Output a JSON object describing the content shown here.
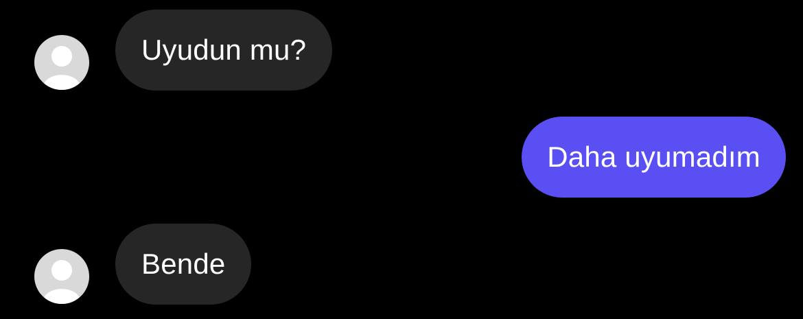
{
  "messages": [
    {
      "sender": "other",
      "text": "Uyudun mu?",
      "avatar_icon": "default-user-icon"
    },
    {
      "sender": "me",
      "text": "Daha uyumadım"
    },
    {
      "sender": "other",
      "text": "Bende",
      "avatar_icon": "default-user-icon"
    }
  ],
  "colors": {
    "background": "#000000",
    "incoming_bubble": "#262626",
    "outgoing_bubble": "#5a4ff3",
    "avatar_background": "#d9d9d9",
    "avatar_figure": "#ffffff",
    "text": "#ffffff"
  }
}
